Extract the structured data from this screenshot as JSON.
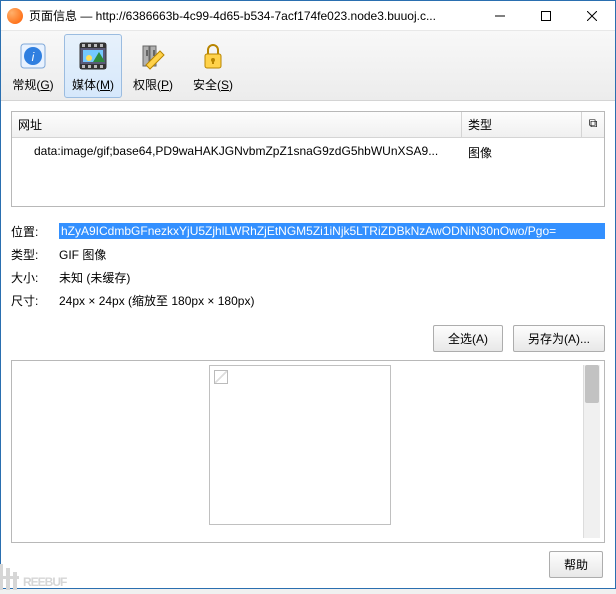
{
  "window": {
    "title": "页面信息 — http://6386663b-4c99-4d65-b534-7acf174fe023.node3.buuoj.c..."
  },
  "toolbar": {
    "general": {
      "label": "常规",
      "key": "G"
    },
    "media": {
      "label": "媒体",
      "key": "M"
    },
    "perm": {
      "label": "权限",
      "key": "P"
    },
    "security": {
      "label": "安全",
      "key": "S"
    }
  },
  "table": {
    "headers": {
      "address": "网址",
      "type": "类型"
    },
    "rows": [
      {
        "address": "data:image/gif;base64,PD9waHAKJGNvbmZpZ1snaG9zdG5hbWUnXSA9...",
        "type": "图像"
      }
    ]
  },
  "detail": {
    "location_label": "位置:",
    "location_value": "hZyA9ICdmbGFnezkxYjU5ZjhlLWRhZjEtNGM5Zi1iNjk5LTRiZDBkNzAwODNiN30nOwo/Pgo=",
    "type_label": "类型:",
    "type_value": "GIF 图像",
    "size_label": "大小:",
    "size_value": "未知 (未缓存)",
    "dim_label": "尺寸:",
    "dim_value": "24px × 24px (缩放至 180px × 180px)"
  },
  "buttons": {
    "select_all": "全选(A)",
    "save_as": "另存为(A)...",
    "help": "帮助"
  },
  "watermark": "REEBUF"
}
